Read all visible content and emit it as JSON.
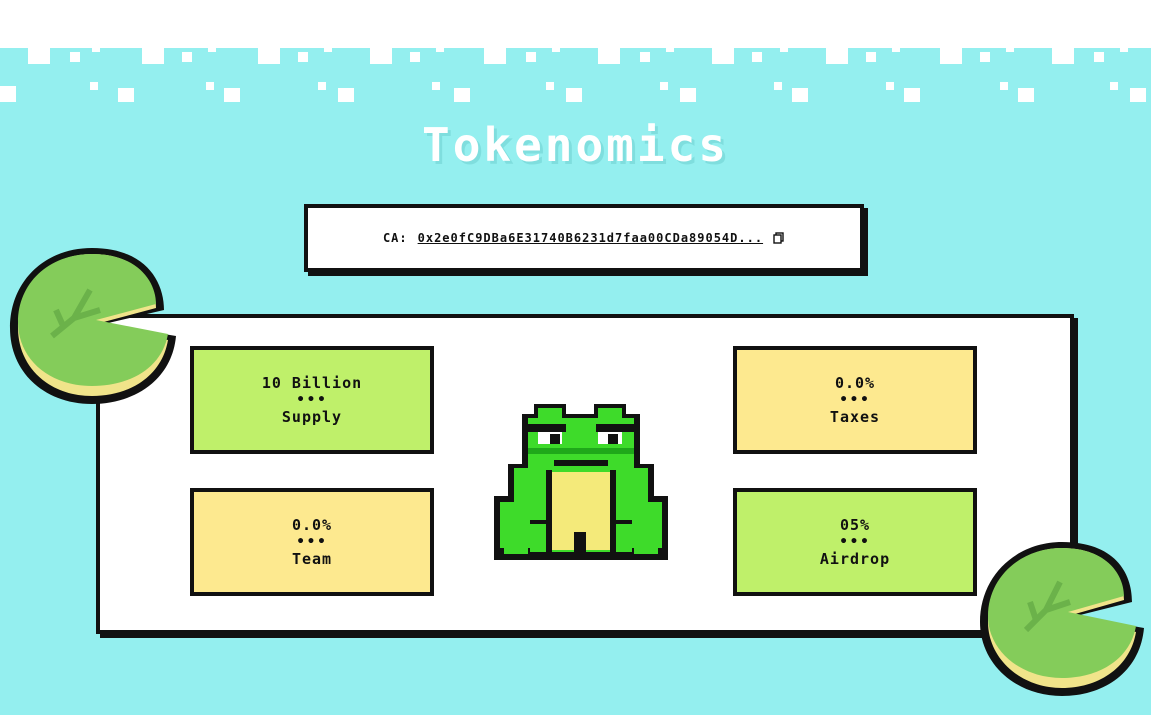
{
  "section": {
    "title": "Tokenomics"
  },
  "contract": {
    "label": "CA:",
    "address": "0x2e0fC9DBa6E31740B6231d7faa00CDa89054D...",
    "copy_icon": "copy-icon"
  },
  "stats": [
    {
      "value": "10 Billion",
      "separator": "•••",
      "label": "Supply",
      "color": "#bff06a"
    },
    {
      "value": "0.0%",
      "separator": "•••",
      "label": "Taxes",
      "color": "#fde98f"
    },
    {
      "value": "0.0%",
      "separator": "•••",
      "label": "Team",
      "color": "#fde98f"
    },
    {
      "value": "05%",
      "separator": "•••",
      "label": "Airdrop",
      "color": "#bff06a"
    }
  ],
  "colors": {
    "background": "#94efef",
    "frog_green": "#3edb2a",
    "lily_green": "#84cc5a",
    "lily_rim": "#f0e48a"
  }
}
